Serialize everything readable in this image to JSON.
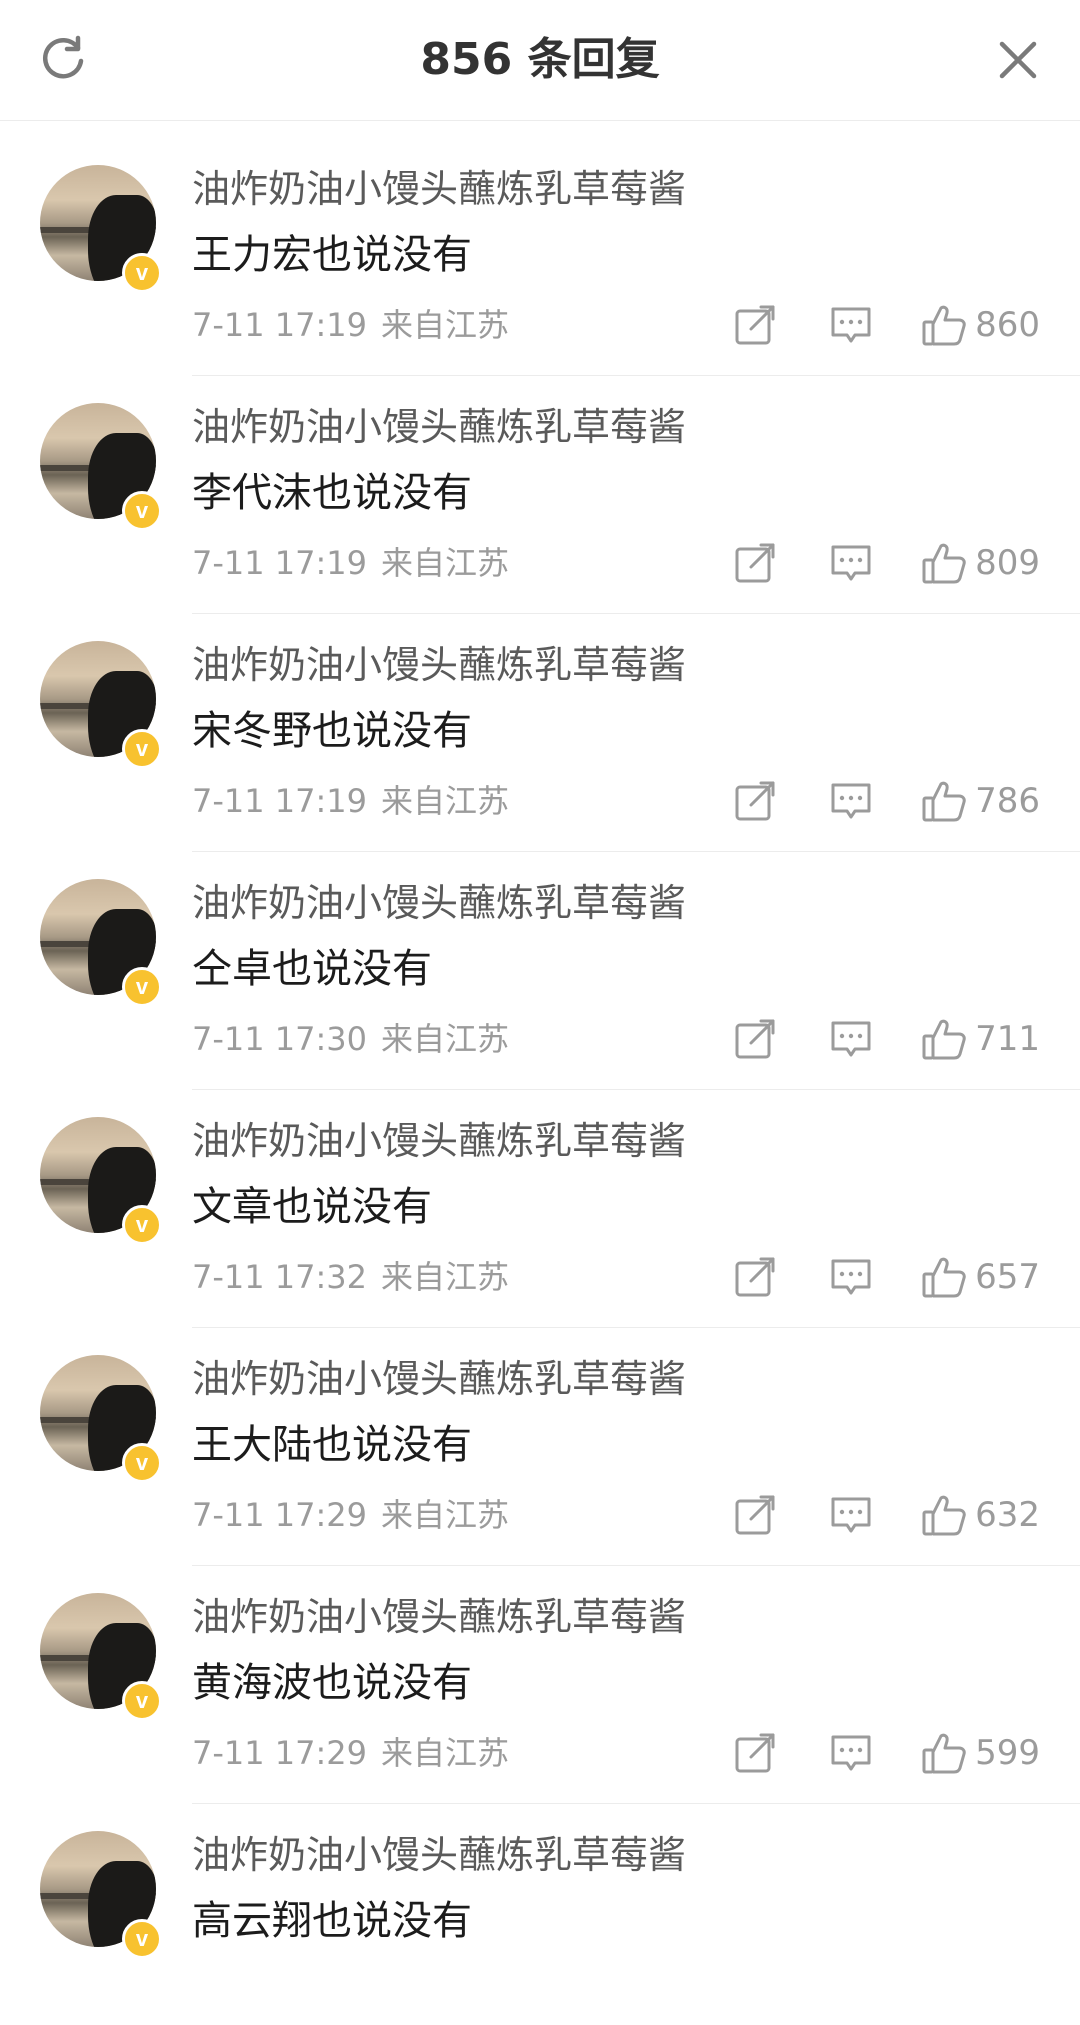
{
  "header": {
    "title": "856 条回复"
  },
  "comments": [
    {
      "user": "油炸奶油小馒头蘸炼乳草莓酱",
      "text": "王力宏也说没有",
      "time": "7-11 17:19",
      "location": "来自江苏",
      "likes": "860"
    },
    {
      "user": "油炸奶油小馒头蘸炼乳草莓酱",
      "text": "李代沫也说没有",
      "time": "7-11 17:19",
      "location": "来自江苏",
      "likes": "809"
    },
    {
      "user": "油炸奶油小馒头蘸炼乳草莓酱",
      "text": "宋冬野也说没有",
      "time": "7-11 17:19",
      "location": "来自江苏",
      "likes": "786"
    },
    {
      "user": "油炸奶油小馒头蘸炼乳草莓酱",
      "text": "仝卓也说没有",
      "time": "7-11 17:30",
      "location": "来自江苏",
      "likes": "711"
    },
    {
      "user": "油炸奶油小馒头蘸炼乳草莓酱",
      "text": "文章也说没有",
      "time": "7-11 17:32",
      "location": "来自江苏",
      "likes": "657"
    },
    {
      "user": "油炸奶油小馒头蘸炼乳草莓酱",
      "text": "王大陆也说没有",
      "time": "7-11 17:29",
      "location": "来自江苏",
      "likes": "632"
    },
    {
      "user": "油炸奶油小馒头蘸炼乳草莓酱",
      "text": "黄海波也说没有",
      "time": "7-11 17:29",
      "location": "来自江苏",
      "likes": "599"
    },
    {
      "user": "油炸奶油小馒头蘸炼乳草莓酱",
      "text": "高云翔也说没有",
      "time": "",
      "location": "",
      "likes": ""
    }
  ],
  "badge": "v",
  "colors": {
    "badge": "#f8c22f",
    "icon": "#9b9b9b",
    "text": "#1c1c1c"
  }
}
